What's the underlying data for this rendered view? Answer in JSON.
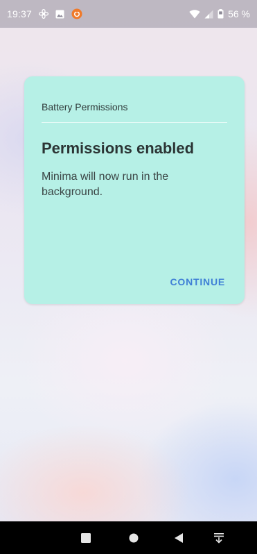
{
  "status_bar": {
    "time": "19:37",
    "battery_percent": "56 %",
    "icons": [
      "fan-icon",
      "image-icon",
      "app-notification-icon",
      "wifi-icon",
      "signal-icon",
      "battery-icon"
    ]
  },
  "dialog": {
    "category": "Battery Permissions",
    "title": "Permissions enabled",
    "message": "Minima will now run in the background.",
    "continue_label": "CONTINUE",
    "accent_color": "#3f7fd6",
    "background_color": "#b6f0e6"
  },
  "nav_bar": {
    "buttons": [
      "recents-button",
      "home-button",
      "back-button",
      "notifications-pull-button"
    ]
  }
}
